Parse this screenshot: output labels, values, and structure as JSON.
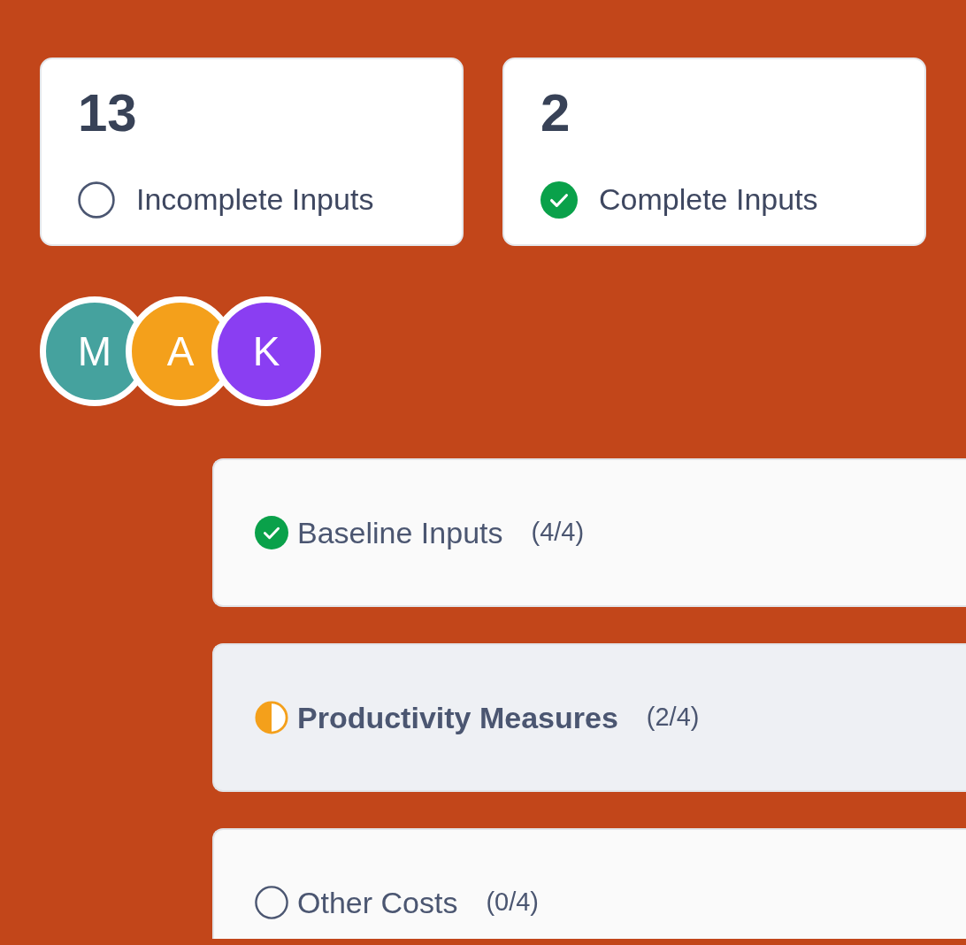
{
  "stats": [
    {
      "value": "13",
      "label": "Incomplete Inputs",
      "kind": "incomplete"
    },
    {
      "value": "2",
      "label": "Complete Inputs",
      "kind": "complete"
    }
  ],
  "avatars": [
    {
      "initial": "M",
      "color": "#45a29e"
    },
    {
      "initial": "A",
      "color": "#f4a01b"
    },
    {
      "initial": "K",
      "color": "#8a3ef2"
    }
  ],
  "sections": [
    {
      "title": "Baseline Inputs",
      "count": "(4/4)",
      "kind": "complete",
      "selected": false
    },
    {
      "title": "Productivity Measures",
      "count": "(2/4)",
      "kind": "partial",
      "selected": true
    },
    {
      "title": "Other Costs",
      "count": "(0/4)",
      "kind": "incomplete",
      "selected": false
    }
  ]
}
